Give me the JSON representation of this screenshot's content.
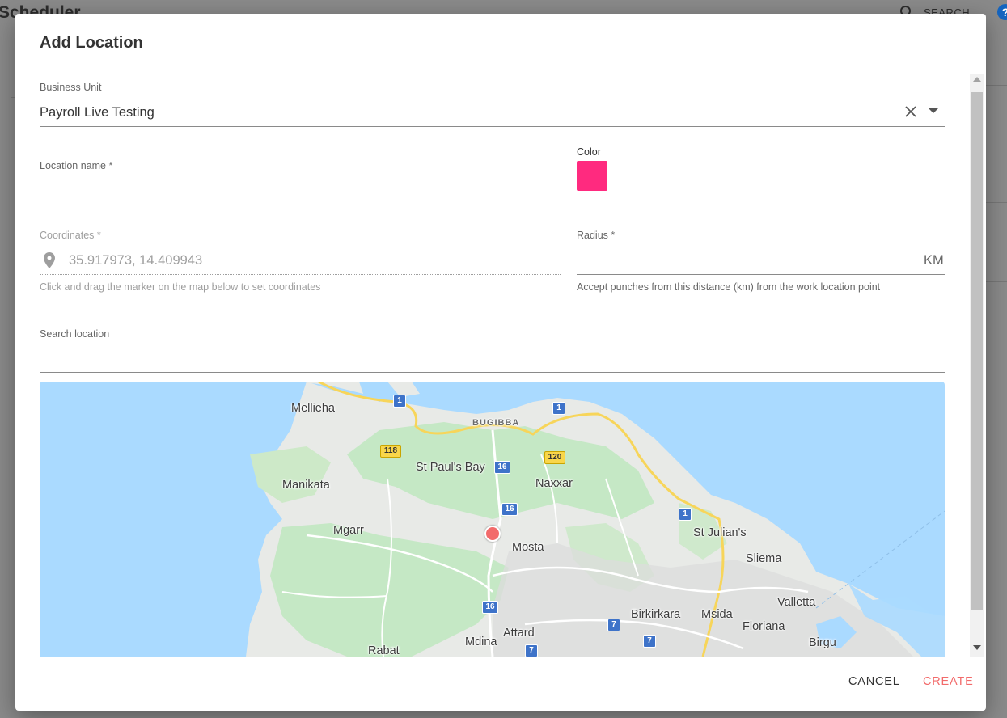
{
  "background": {
    "app_title": "Scheduler",
    "search_label": "SEARCH",
    "help_glyph": "?"
  },
  "dialog": {
    "title": "Add Location",
    "business_unit": {
      "label": "Business Unit",
      "value": "Payroll Live Testing"
    },
    "location_name": {
      "label": "Location name *",
      "value": ""
    },
    "color": {
      "label": "Color",
      "value": "#ff2a7f"
    },
    "coordinates": {
      "label": "Coordinates *",
      "value": "35.917973, 14.409943",
      "helper": "Click and drag the marker on the map below to set coordinates"
    },
    "radius": {
      "label": "Radius *",
      "value": "",
      "unit": "KM",
      "helper": "Accept punches from this distance (km) from the work location point"
    },
    "search_location": {
      "label": "Search location",
      "value": ""
    },
    "map": {
      "places": [
        "Mellieha",
        "BUGIBBA",
        "St Paul's Bay",
        "Manikata",
        "Naxxar",
        "Mgarr",
        "Mosta",
        "St Julian's",
        "Sliema",
        "Valletta",
        "Birkirkara",
        "Msida",
        "Floriana",
        "Attard",
        "Mdina",
        "Rabat",
        "Birgu"
      ],
      "road_numbers": [
        "1",
        "1",
        "118",
        "16",
        "120",
        "16",
        "1",
        "16",
        "7",
        "7",
        "7"
      ]
    },
    "actions": {
      "cancel": "CANCEL",
      "create": "CREATE"
    }
  },
  "colors": {
    "accent_create": "#f26b6b",
    "swatch": "#ff2a7f",
    "water": "#aadaff",
    "land": "#e8eae7",
    "park": "#c5e8c5"
  }
}
